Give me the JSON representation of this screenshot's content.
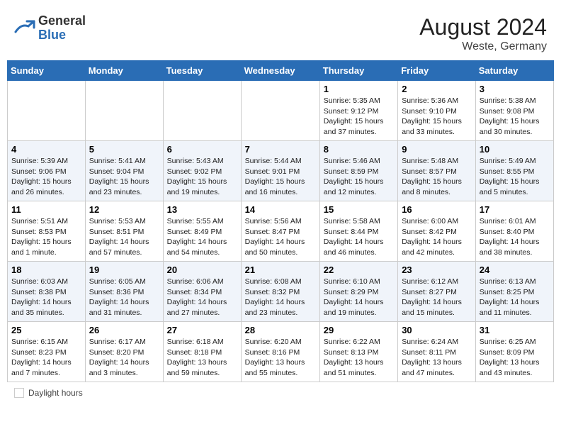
{
  "header": {
    "logo_general": "General",
    "logo_blue": "Blue",
    "month_year": "August 2024",
    "location": "Weste, Germany"
  },
  "footer": {
    "daylight_label": "Daylight hours"
  },
  "days_of_week": [
    "Sunday",
    "Monday",
    "Tuesday",
    "Wednesday",
    "Thursday",
    "Friday",
    "Saturday"
  ],
  "weeks": [
    [
      {
        "day": "",
        "info": ""
      },
      {
        "day": "",
        "info": ""
      },
      {
        "day": "",
        "info": ""
      },
      {
        "day": "",
        "info": ""
      },
      {
        "day": "1",
        "info": "Sunrise: 5:35 AM\nSunset: 9:12 PM\nDaylight: 15 hours\nand 37 minutes."
      },
      {
        "day": "2",
        "info": "Sunrise: 5:36 AM\nSunset: 9:10 PM\nDaylight: 15 hours\nand 33 minutes."
      },
      {
        "day": "3",
        "info": "Sunrise: 5:38 AM\nSunset: 9:08 PM\nDaylight: 15 hours\nand 30 minutes."
      }
    ],
    [
      {
        "day": "4",
        "info": "Sunrise: 5:39 AM\nSunset: 9:06 PM\nDaylight: 15 hours\nand 26 minutes."
      },
      {
        "day": "5",
        "info": "Sunrise: 5:41 AM\nSunset: 9:04 PM\nDaylight: 15 hours\nand 23 minutes."
      },
      {
        "day": "6",
        "info": "Sunrise: 5:43 AM\nSunset: 9:02 PM\nDaylight: 15 hours\nand 19 minutes."
      },
      {
        "day": "7",
        "info": "Sunrise: 5:44 AM\nSunset: 9:01 PM\nDaylight: 15 hours\nand 16 minutes."
      },
      {
        "day": "8",
        "info": "Sunrise: 5:46 AM\nSunset: 8:59 PM\nDaylight: 15 hours\nand 12 minutes."
      },
      {
        "day": "9",
        "info": "Sunrise: 5:48 AM\nSunset: 8:57 PM\nDaylight: 15 hours\nand 8 minutes."
      },
      {
        "day": "10",
        "info": "Sunrise: 5:49 AM\nSunset: 8:55 PM\nDaylight: 15 hours\nand 5 minutes."
      }
    ],
    [
      {
        "day": "11",
        "info": "Sunrise: 5:51 AM\nSunset: 8:53 PM\nDaylight: 15 hours\nand 1 minute."
      },
      {
        "day": "12",
        "info": "Sunrise: 5:53 AM\nSunset: 8:51 PM\nDaylight: 14 hours\nand 57 minutes."
      },
      {
        "day": "13",
        "info": "Sunrise: 5:55 AM\nSunset: 8:49 PM\nDaylight: 14 hours\nand 54 minutes."
      },
      {
        "day": "14",
        "info": "Sunrise: 5:56 AM\nSunset: 8:47 PM\nDaylight: 14 hours\nand 50 minutes."
      },
      {
        "day": "15",
        "info": "Sunrise: 5:58 AM\nSunset: 8:44 PM\nDaylight: 14 hours\nand 46 minutes."
      },
      {
        "day": "16",
        "info": "Sunrise: 6:00 AM\nSunset: 8:42 PM\nDaylight: 14 hours\nand 42 minutes."
      },
      {
        "day": "17",
        "info": "Sunrise: 6:01 AM\nSunset: 8:40 PM\nDaylight: 14 hours\nand 38 minutes."
      }
    ],
    [
      {
        "day": "18",
        "info": "Sunrise: 6:03 AM\nSunset: 8:38 PM\nDaylight: 14 hours\nand 35 minutes."
      },
      {
        "day": "19",
        "info": "Sunrise: 6:05 AM\nSunset: 8:36 PM\nDaylight: 14 hours\nand 31 minutes."
      },
      {
        "day": "20",
        "info": "Sunrise: 6:06 AM\nSunset: 8:34 PM\nDaylight: 14 hours\nand 27 minutes."
      },
      {
        "day": "21",
        "info": "Sunrise: 6:08 AM\nSunset: 8:32 PM\nDaylight: 14 hours\nand 23 minutes."
      },
      {
        "day": "22",
        "info": "Sunrise: 6:10 AM\nSunset: 8:29 PM\nDaylight: 14 hours\nand 19 minutes."
      },
      {
        "day": "23",
        "info": "Sunrise: 6:12 AM\nSunset: 8:27 PM\nDaylight: 14 hours\nand 15 minutes."
      },
      {
        "day": "24",
        "info": "Sunrise: 6:13 AM\nSunset: 8:25 PM\nDaylight: 14 hours\nand 11 minutes."
      }
    ],
    [
      {
        "day": "25",
        "info": "Sunrise: 6:15 AM\nSunset: 8:23 PM\nDaylight: 14 hours\nand 7 minutes."
      },
      {
        "day": "26",
        "info": "Sunrise: 6:17 AM\nSunset: 8:20 PM\nDaylight: 14 hours\nand 3 minutes."
      },
      {
        "day": "27",
        "info": "Sunrise: 6:18 AM\nSunset: 8:18 PM\nDaylight: 13 hours\nand 59 minutes."
      },
      {
        "day": "28",
        "info": "Sunrise: 6:20 AM\nSunset: 8:16 PM\nDaylight: 13 hours\nand 55 minutes."
      },
      {
        "day": "29",
        "info": "Sunrise: 6:22 AM\nSunset: 8:13 PM\nDaylight: 13 hours\nand 51 minutes."
      },
      {
        "day": "30",
        "info": "Sunrise: 6:24 AM\nSunset: 8:11 PM\nDaylight: 13 hours\nand 47 minutes."
      },
      {
        "day": "31",
        "info": "Sunrise: 6:25 AM\nSunset: 8:09 PM\nDaylight: 13 hours\nand 43 minutes."
      }
    ]
  ]
}
